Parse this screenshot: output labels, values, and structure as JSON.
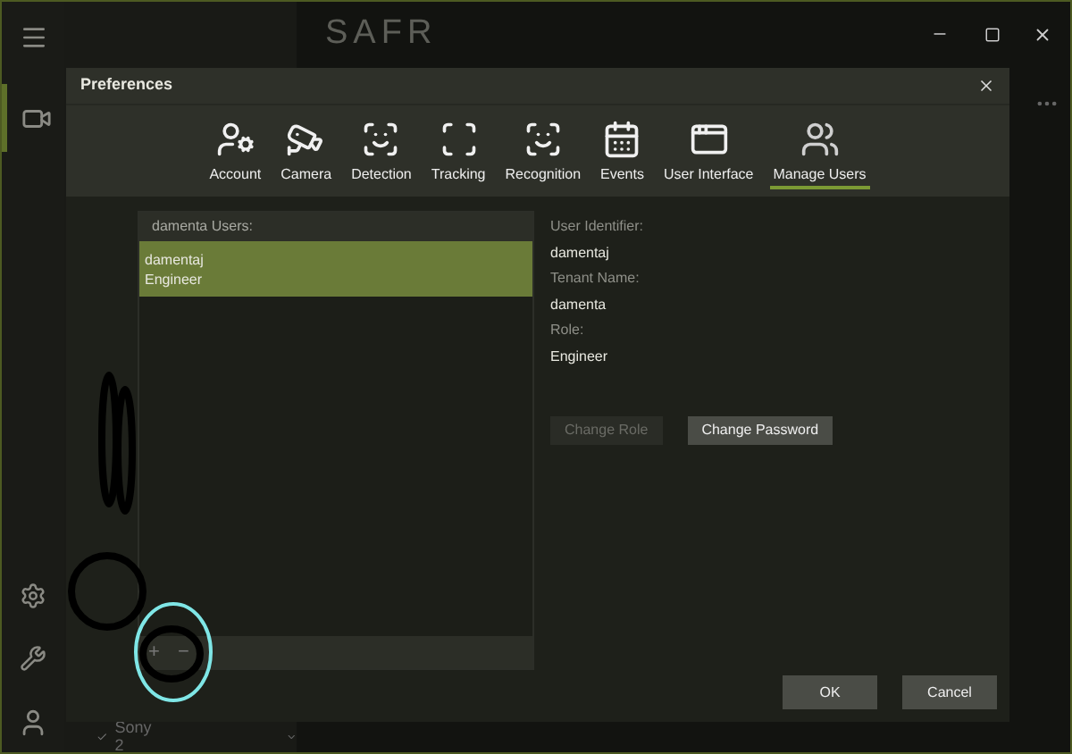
{
  "app": {
    "logo": "SAFR",
    "bottom_item": {
      "label": "Sony 2",
      "checked": true
    }
  },
  "dialog": {
    "title": "Preferences",
    "tabs": [
      {
        "label": "Account",
        "selected": false
      },
      {
        "label": "Camera",
        "selected": false
      },
      {
        "label": "Detection",
        "selected": false
      },
      {
        "label": "Tracking",
        "selected": false
      },
      {
        "label": "Recognition",
        "selected": false
      },
      {
        "label": "Events",
        "selected": false
      },
      {
        "label": "User Interface",
        "selected": false
      },
      {
        "label": "Manage Users",
        "selected": true
      }
    ],
    "users_list": {
      "header": "damenta Users:",
      "users": [
        {
          "name": "damentaj",
          "role": "Engineer",
          "selected": true
        }
      ],
      "add_label": "+",
      "remove_label": "−"
    },
    "details": [
      {
        "label": "User Identifier:",
        "value": "damentaj"
      },
      {
        "label": "Tenant Name:",
        "value": "damenta"
      },
      {
        "label": "Role:",
        "value": "Engineer"
      }
    ],
    "buttons": [
      {
        "label": "Change Role",
        "disabled": true
      },
      {
        "label": "Change Password",
        "disabled": false
      }
    ],
    "footer_buttons": [
      "OK",
      "Cancel"
    ]
  }
}
